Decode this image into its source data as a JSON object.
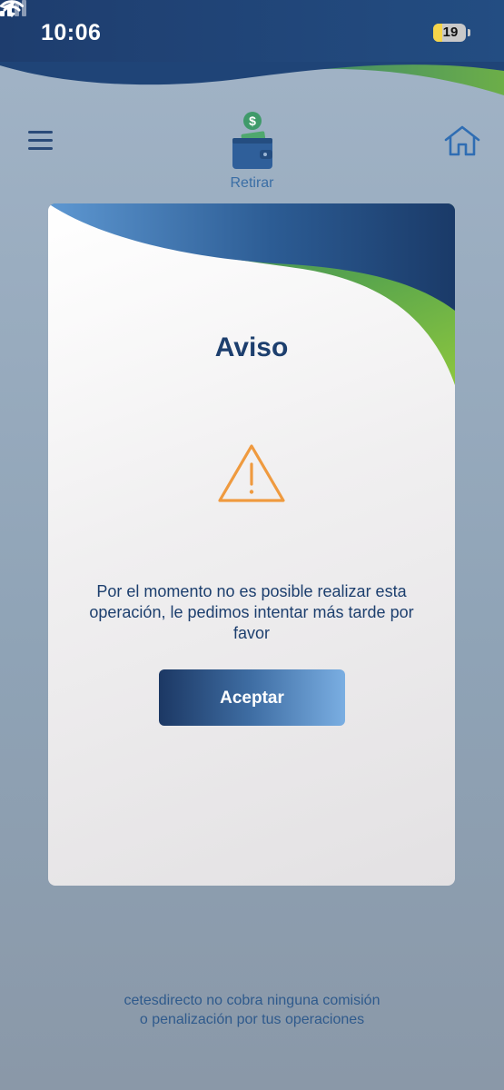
{
  "status_bar": {
    "time": "10:06",
    "battery": "19"
  },
  "nav": {
    "section_label": "Retirar",
    "icons": [
      "menu-icon",
      "wallet-icon",
      "home-icon"
    ]
  },
  "dialog": {
    "title": "Aviso",
    "message": "Por el momento no es posible realizar esta operación, le pedimos intentar más tarde por favor",
    "button_label": "Aceptar",
    "icon": "warning-icon"
  },
  "footer": {
    "line1": "cetesdirecto no cobra ninguna comisión",
    "line2": "o penalización por tus operaciones"
  },
  "colors": {
    "brand_dark_blue": "#1d3f6e",
    "accent_green": "#7cb848",
    "warning_orange": "#ef9a3f"
  }
}
